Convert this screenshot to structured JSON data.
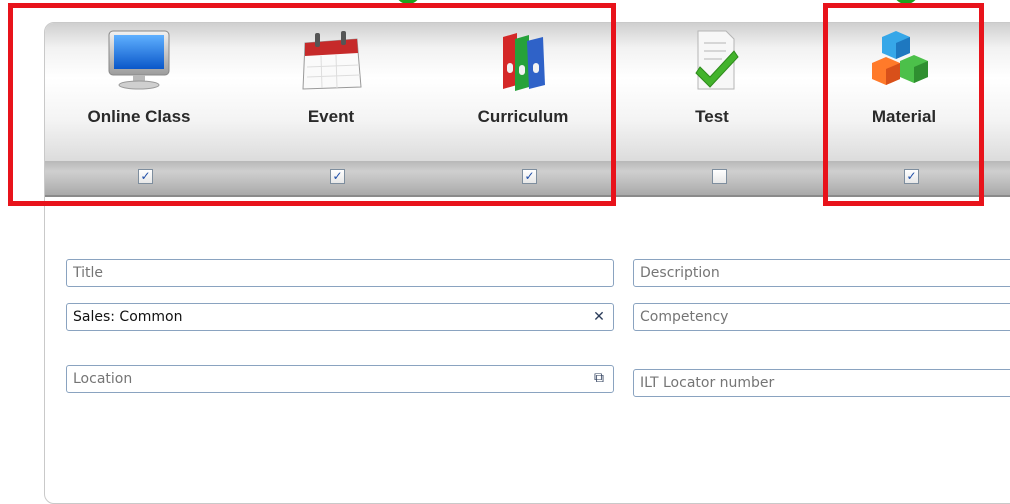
{
  "toolbar": {
    "items": [
      {
        "label": "Online Class",
        "icon": "monitor-icon",
        "checked": true,
        "check_glyph": "✓"
      },
      {
        "label": "Event",
        "icon": "calendar-icon",
        "checked": true,
        "check_glyph": "✓"
      },
      {
        "label": "Curriculum",
        "icon": "binders-icon",
        "checked": true,
        "check_glyph": "✓"
      },
      {
        "label": "Test",
        "icon": "test-document-icon",
        "checked": false,
        "check_glyph": ""
      },
      {
        "label": "Material",
        "icon": "cubes-icon",
        "checked": true,
        "check_glyph": "✓"
      }
    ]
  },
  "form": {
    "title_placeholder": "Title",
    "description_placeholder": "Description",
    "sales_value": "Sales: Common",
    "competency_placeholder": "Competency",
    "location_placeholder": "Location",
    "ilt_placeholder": "ILT Locator number",
    "clear_glyph": "✕",
    "lookup_glyph": "⧉"
  },
  "colors": {
    "highlight_red": "#e8131b",
    "highlight_green": "#1fa21f",
    "field_border": "#8aa3c0"
  }
}
